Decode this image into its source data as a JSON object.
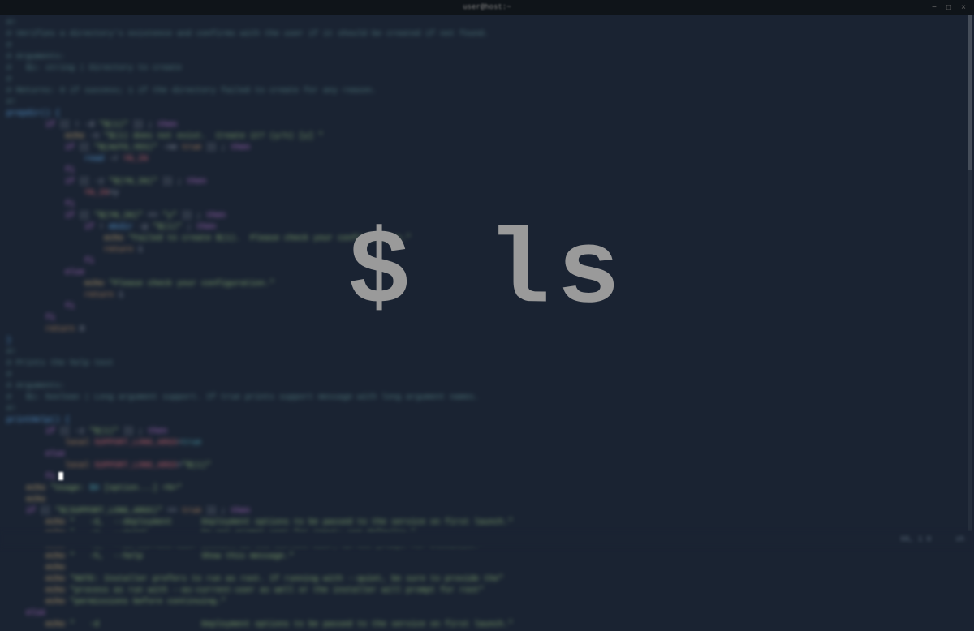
{
  "titlebar": {
    "title": "user@host:~"
  },
  "overlay": {
    "command": "$ ls"
  },
  "statusbar": {
    "position": "68, 1  0",
    "mode": "sh"
  },
  "code": {
    "lines": [
      {
        "cls": "comment",
        "text": "#!"
      },
      {
        "cls": "comment",
        "text": "# Verifies a directory's existence and confirms with the user if it should be created if not found."
      },
      {
        "cls": "comment",
        "text": "#"
      },
      {
        "cls": "comment",
        "text": "# Arguments:"
      },
      {
        "cls": "comment",
        "text": "#   $1: string | Directory to create"
      },
      {
        "cls": "comment",
        "text": "#"
      },
      {
        "cls": "comment",
        "text": "# Returns: 0 if success; 1 if the directory failed to create for any reason."
      },
      {
        "cls": "comment",
        "text": "#!"
      },
      {
        "cls": "func",
        "text": "prepdir() {"
      },
      {
        "cls": "mixed",
        "segments": [
          {
            "cls": "op",
            "text": "        "
          },
          {
            "cls": "keyword",
            "text": "if"
          },
          {
            "cls": "op",
            "text": " [[ ! -d "
          },
          {
            "cls": "string",
            "text": "\"$(1)\""
          },
          {
            "cls": "op",
            "text": " ]] ; "
          },
          {
            "cls": "keyword",
            "text": "then"
          }
        ]
      },
      {
        "cls": "mixed",
        "segments": [
          {
            "cls": "op",
            "text": "            "
          },
          {
            "cls": "echo-kw",
            "text": "echo"
          },
          {
            "cls": "op",
            "text": " -n "
          },
          {
            "cls": "string",
            "text": "\"$(1) does not exist.  Create it? (y/n) [y] \""
          }
        ]
      },
      {
        "cls": "mixed",
        "segments": [
          {
            "cls": "op",
            "text": "            "
          },
          {
            "cls": "keyword",
            "text": "if"
          },
          {
            "cls": "op",
            "text": " [[ "
          },
          {
            "cls": "string",
            "text": "\"$(AUTO_YES)\""
          },
          {
            "cls": "op",
            "text": " -ne "
          },
          {
            "cls": "keyword2",
            "text": "true"
          },
          {
            "cls": "op",
            "text": " ]] ; "
          },
          {
            "cls": "keyword",
            "text": "then"
          }
        ]
      },
      {
        "cls": "mixed",
        "segments": [
          {
            "cls": "op",
            "text": "                "
          },
          {
            "cls": "func",
            "text": "read"
          },
          {
            "cls": "op",
            "text": " -r "
          },
          {
            "cls": "var",
            "text": "YN_IN"
          }
        ]
      },
      {
        "cls": "mixed",
        "segments": [
          {
            "cls": "op",
            "text": "            "
          },
          {
            "cls": "keyword",
            "text": "fi"
          }
        ]
      },
      {
        "cls": "mixed",
        "segments": [
          {
            "cls": "op",
            "text": "            "
          },
          {
            "cls": "keyword",
            "text": "if"
          },
          {
            "cls": "op",
            "text": " [[ -z "
          },
          {
            "cls": "string",
            "text": "\"$(YN_IN)\""
          },
          {
            "cls": "op",
            "text": " ]] ; "
          },
          {
            "cls": "keyword",
            "text": "then"
          }
        ]
      },
      {
        "cls": "mixed",
        "segments": [
          {
            "cls": "op",
            "text": "                "
          },
          {
            "cls": "var",
            "text": "YN_IN"
          },
          {
            "cls": "op",
            "text": "=y"
          }
        ]
      },
      {
        "cls": "mixed",
        "segments": [
          {
            "cls": "op",
            "text": "            "
          },
          {
            "cls": "keyword",
            "text": "fi"
          }
        ]
      },
      {
        "cls": "mixed",
        "segments": [
          {
            "cls": "op",
            "text": "            "
          },
          {
            "cls": "keyword",
            "text": "if"
          },
          {
            "cls": "op",
            "text": " [[ "
          },
          {
            "cls": "string",
            "text": "\"$(YN_IN)\""
          },
          {
            "cls": "op",
            "text": " == "
          },
          {
            "cls": "string",
            "text": "\"y\""
          },
          {
            "cls": "op",
            "text": " ]] ; "
          },
          {
            "cls": "keyword",
            "text": "then"
          }
        ]
      },
      {
        "cls": "mixed",
        "segments": [
          {
            "cls": "op",
            "text": "                "
          },
          {
            "cls": "keyword",
            "text": "if"
          },
          {
            "cls": "op",
            "text": " ! "
          },
          {
            "cls": "func",
            "text": "mkdir"
          },
          {
            "cls": "op",
            "text": " -p "
          },
          {
            "cls": "string",
            "text": "\"$(1)\""
          },
          {
            "cls": "op",
            "text": " ; "
          },
          {
            "cls": "keyword",
            "text": "then"
          }
        ]
      },
      {
        "cls": "mixed",
        "segments": [
          {
            "cls": "op",
            "text": "                    "
          },
          {
            "cls": "echo-kw",
            "text": "echo"
          },
          {
            "cls": "op",
            "text": " "
          },
          {
            "cls": "string",
            "text": "\"Failed to create $(1).  Please check your configuration.\""
          }
        ]
      },
      {
        "cls": "mixed",
        "segments": [
          {
            "cls": "op",
            "text": "                    "
          },
          {
            "cls": "keyword2",
            "text": "return"
          },
          {
            "cls": "op",
            "text": " 1"
          }
        ]
      },
      {
        "cls": "mixed",
        "segments": [
          {
            "cls": "op",
            "text": "                "
          },
          {
            "cls": "keyword",
            "text": "fi"
          }
        ]
      },
      {
        "cls": "mixed",
        "segments": [
          {
            "cls": "op",
            "text": "            "
          },
          {
            "cls": "keyword",
            "text": "else"
          }
        ]
      },
      {
        "cls": "mixed",
        "segments": [
          {
            "cls": "op",
            "text": "                "
          },
          {
            "cls": "echo-kw",
            "text": "echo"
          },
          {
            "cls": "op",
            "text": " "
          },
          {
            "cls": "string",
            "text": "\"Please check your configuration.\""
          }
        ]
      },
      {
        "cls": "mixed",
        "segments": [
          {
            "cls": "op",
            "text": "                "
          },
          {
            "cls": "keyword2",
            "text": "return"
          },
          {
            "cls": "op",
            "text": " 1"
          }
        ]
      },
      {
        "cls": "mixed",
        "segments": [
          {
            "cls": "op",
            "text": "            "
          },
          {
            "cls": "keyword",
            "text": "fi"
          }
        ]
      },
      {
        "cls": "mixed",
        "segments": [
          {
            "cls": "op",
            "text": "        "
          },
          {
            "cls": "keyword",
            "text": "fi"
          }
        ]
      },
      {
        "cls": "mixed",
        "segments": [
          {
            "cls": "op",
            "text": "        "
          },
          {
            "cls": "keyword2",
            "text": "return"
          },
          {
            "cls": "op",
            "text": " 0"
          }
        ]
      },
      {
        "cls": "func",
        "text": "}"
      },
      {
        "cls": "op",
        "text": ""
      },
      {
        "cls": "comment",
        "text": "#!"
      },
      {
        "cls": "comment",
        "text": "# Prints the help text"
      },
      {
        "cls": "comment",
        "text": "#"
      },
      {
        "cls": "comment",
        "text": "# Arguments:"
      },
      {
        "cls": "comment",
        "text": "#   $1: boolean | Long argument support. If true prints support message with long argument names."
      },
      {
        "cls": "comment",
        "text": "#!"
      },
      {
        "cls": "func",
        "text": "printHelp() {"
      },
      {
        "cls": "mixed",
        "segments": [
          {
            "cls": "op",
            "text": "        "
          },
          {
            "cls": "keyword",
            "text": "if"
          },
          {
            "cls": "op",
            "text": " [[ -z "
          },
          {
            "cls": "string",
            "text": "\"$(1)\""
          },
          {
            "cls": "op",
            "text": " ]] ; "
          },
          {
            "cls": "keyword",
            "text": "then"
          }
        ]
      },
      {
        "cls": "mixed",
        "segments": [
          {
            "cls": "op",
            "text": "            "
          },
          {
            "cls": "keyword2",
            "text": "local"
          },
          {
            "cls": "op",
            "text": " "
          },
          {
            "cls": "var",
            "text": "SUPPORT_LONG_ARGS"
          },
          {
            "cls": "op",
            "text": "="
          },
          {
            "cls": "teal",
            "text": "true"
          }
        ]
      },
      {
        "cls": "mixed",
        "segments": [
          {
            "cls": "op",
            "text": "        "
          },
          {
            "cls": "keyword",
            "text": "else"
          }
        ]
      },
      {
        "cls": "mixed",
        "segments": [
          {
            "cls": "op",
            "text": "            "
          },
          {
            "cls": "keyword2",
            "text": "local"
          },
          {
            "cls": "op",
            "text": " "
          },
          {
            "cls": "var",
            "text": "SUPPORT_LONG_ARGS"
          },
          {
            "cls": "op",
            "text": "="
          },
          {
            "cls": "string",
            "text": "\"$(1)\""
          }
        ]
      },
      {
        "cls": "mixed",
        "segments": [
          {
            "cls": "op",
            "text": "        "
          },
          {
            "cls": "keyword",
            "text": "fi"
          }
        ]
      },
      {
        "cls": "op",
        "text": ""
      },
      {
        "cls": "mixed",
        "segments": [
          {
            "cls": "op",
            "text": "    "
          },
          {
            "cls": "echo-kw",
            "text": "echo"
          },
          {
            "cls": "op",
            "text": " "
          },
          {
            "cls": "string",
            "text": "\"Usage: "
          },
          {
            "cls": "teal",
            "text": "$0"
          },
          {
            "cls": "string",
            "text": " [option...] <%>\""
          }
        ]
      },
      {
        "cls": "mixed",
        "segments": [
          {
            "cls": "op",
            "text": "    "
          },
          {
            "cls": "echo-kw",
            "text": "echo"
          }
        ]
      },
      {
        "cls": "mixed",
        "segments": [
          {
            "cls": "op",
            "text": "    "
          },
          {
            "cls": "keyword",
            "text": "if"
          },
          {
            "cls": "op",
            "text": " [[ "
          },
          {
            "cls": "string",
            "text": "\"$(SUPPORT_LONG_ARGS)\""
          },
          {
            "cls": "op",
            "text": " == "
          },
          {
            "cls": "keyword2",
            "text": "true"
          },
          {
            "cls": "op",
            "text": " ]] ; "
          },
          {
            "cls": "keyword",
            "text": "then"
          }
        ]
      },
      {
        "cls": "mixed",
        "segments": [
          {
            "cls": "op",
            "text": "        "
          },
          {
            "cls": "echo-kw",
            "text": "echo"
          },
          {
            "cls": "op",
            "text": " "
          },
          {
            "cls": "string",
            "text": "\"   -d,  --deployment      Deployment options to be passed to the service on first launch.\""
          }
        ]
      },
      {
        "cls": "mixed",
        "segments": [
          {
            "cls": "op",
            "text": "        "
          },
          {
            "cls": "echo-kw",
            "text": "echo"
          },
          {
            "cls": "op",
            "text": " "
          },
          {
            "cls": "string",
            "text": "\"   -q,  --quiet           Do not prompt user for input; use defaults.\""
          }
        ]
      },
      {
        "cls": "mixed",
        "segments": [
          {
            "cls": "op",
            "text": "        "
          },
          {
            "cls": "echo-kw",
            "text": "echo"
          },
          {
            "cls": "op",
            "text": " "
          },
          {
            "cls": "string",
            "text": "\"   -u,  --as-current-user Install as the current user; do not prompt for elevation.\""
          }
        ]
      },
      {
        "cls": "mixed",
        "segments": [
          {
            "cls": "op",
            "text": "        "
          },
          {
            "cls": "echo-kw",
            "text": "echo"
          },
          {
            "cls": "op",
            "text": " "
          },
          {
            "cls": "string",
            "text": "\"   -h,  --help            Show this message.\""
          }
        ]
      },
      {
        "cls": "mixed",
        "segments": [
          {
            "cls": "op",
            "text": "        "
          },
          {
            "cls": "echo-kw",
            "text": "echo"
          }
        ]
      },
      {
        "cls": "mixed",
        "segments": [
          {
            "cls": "op",
            "text": "        "
          },
          {
            "cls": "echo-kw",
            "text": "echo"
          },
          {
            "cls": "op",
            "text": " "
          },
          {
            "cls": "string",
            "text": "\"NOTE: Installer prefers to run as root. If running with --quiet, be sure to provide the\""
          }
        ]
      },
      {
        "cls": "mixed",
        "segments": [
          {
            "cls": "op",
            "text": "        "
          },
          {
            "cls": "echo-kw",
            "text": "echo"
          },
          {
            "cls": "op",
            "text": " "
          },
          {
            "cls": "string",
            "text": "\"process as run with --as-current-user as well or the installer will prompt for root\""
          }
        ]
      },
      {
        "cls": "mixed",
        "segments": [
          {
            "cls": "op",
            "text": "        "
          },
          {
            "cls": "echo-kw",
            "text": "echo"
          },
          {
            "cls": "op",
            "text": " "
          },
          {
            "cls": "string",
            "text": "\"permissions before continuing.\""
          }
        ]
      },
      {
        "cls": "mixed",
        "segments": [
          {
            "cls": "op",
            "text": "    "
          },
          {
            "cls": "keyword",
            "text": "else"
          }
        ]
      },
      {
        "cls": "mixed",
        "segments": [
          {
            "cls": "op",
            "text": "        "
          },
          {
            "cls": "echo-kw",
            "text": "echo"
          },
          {
            "cls": "op",
            "text": " "
          },
          {
            "cls": "string",
            "text": "\"   -d                     Deployment options to be passed to the service on first launch.\""
          }
        ]
      }
    ]
  }
}
